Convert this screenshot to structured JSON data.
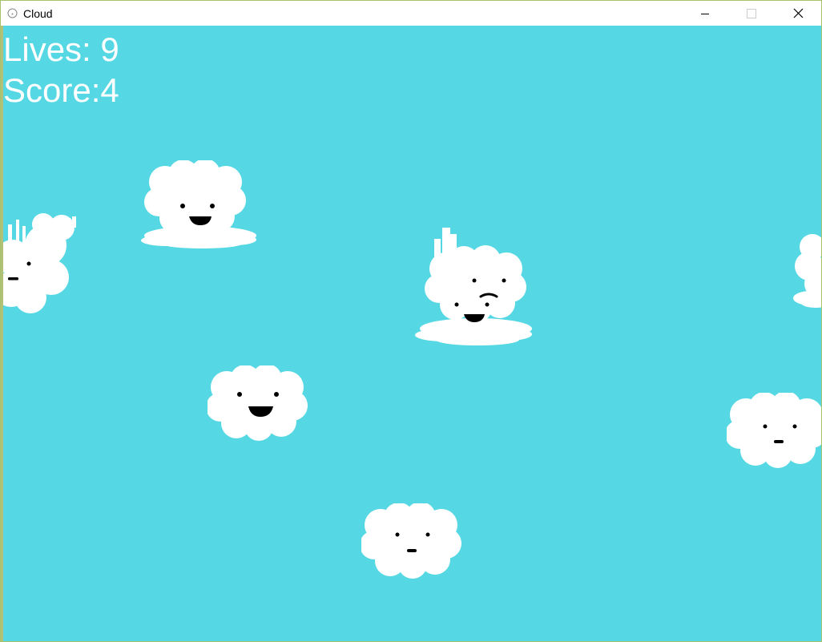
{
  "window": {
    "title": "Cloud",
    "controls": [
      "minimize-icon",
      "maximize-icon",
      "close-icon"
    ]
  },
  "hud": {
    "lives_text": "Lives: 9",
    "score_text": "Score:4"
  },
  "colors": {
    "sky": "#55d8e3",
    "cloud": "#ffffff",
    "face": "#000000",
    "text": "#ffffff",
    "window_border": "#a6c26a"
  }
}
